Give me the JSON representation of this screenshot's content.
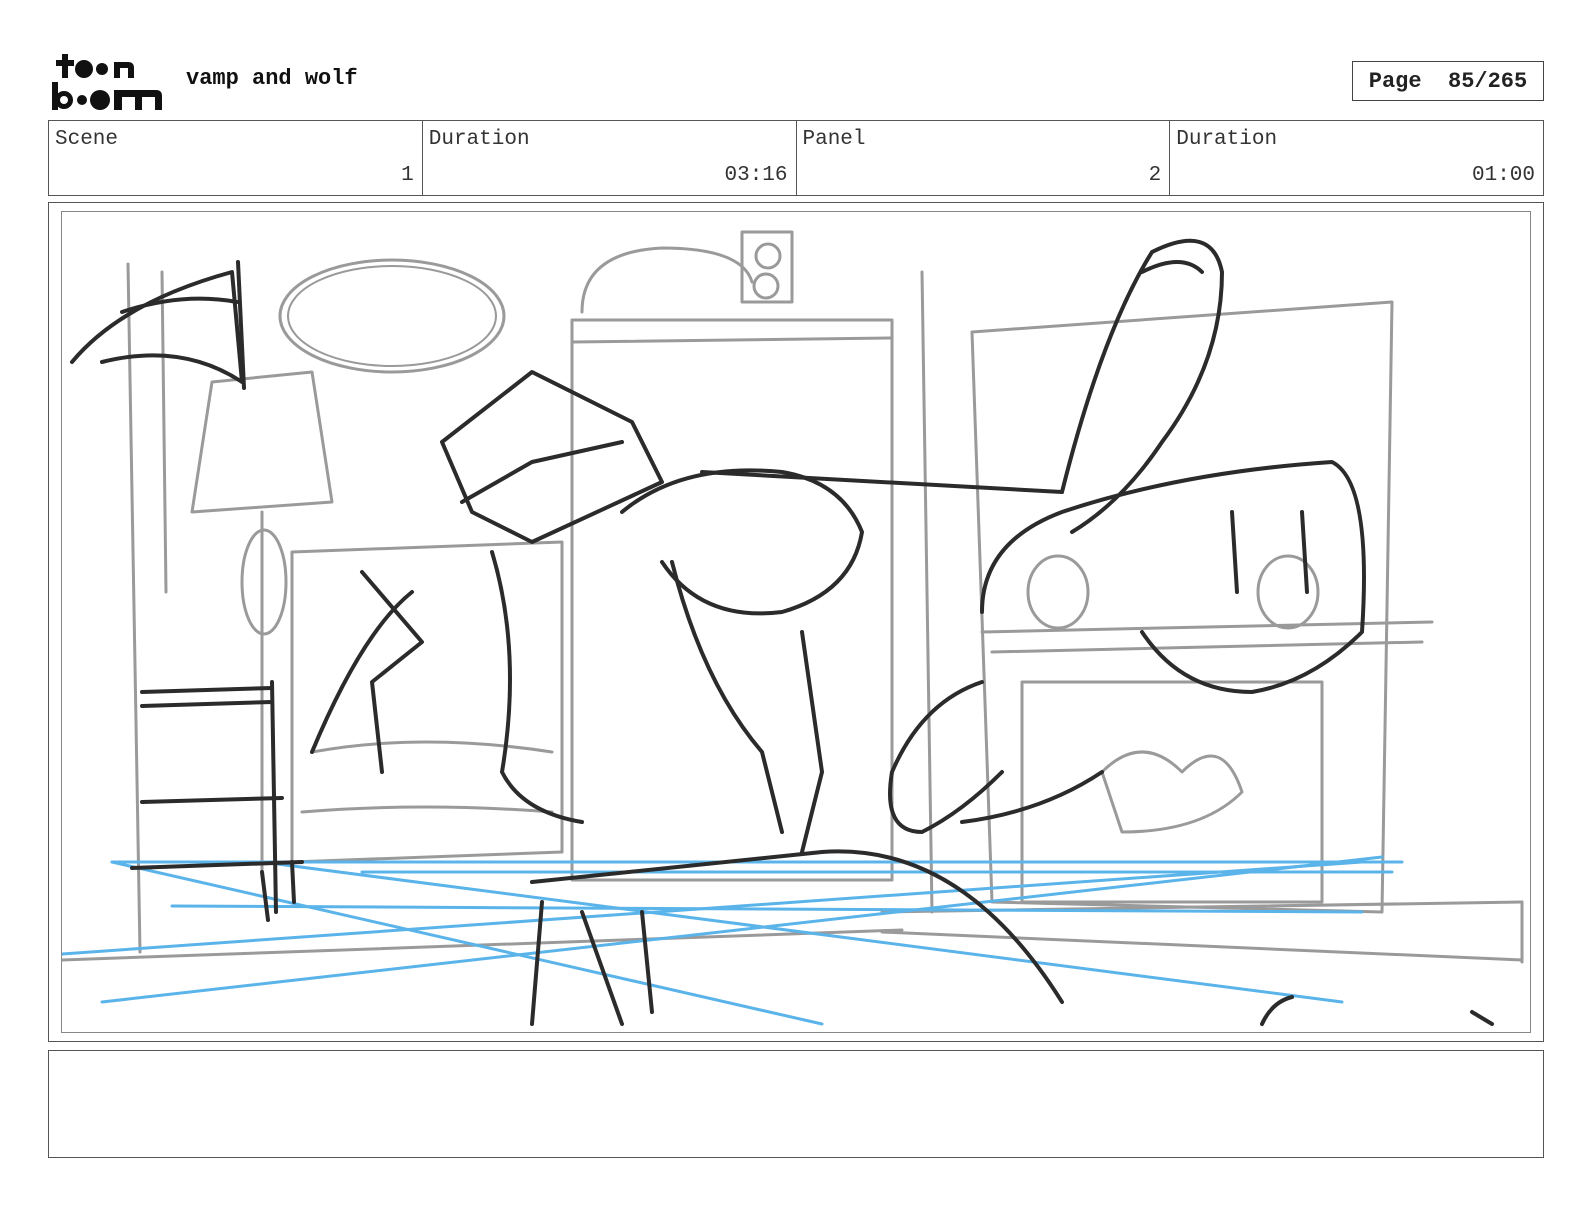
{
  "header": {
    "logo_top": "t●●n",
    "logo_bottom": "b●●m",
    "project_title": "vamp and wolf",
    "page_label": "Page",
    "page_number": "85/265"
  },
  "info": {
    "scene_label": "Scene",
    "scene_value": "1",
    "scene_duration_label": "Duration",
    "scene_duration_value": "03:16",
    "panel_label": "Panel",
    "panel_value": "2",
    "panel_duration_label": "Duration",
    "panel_duration_value": "01:00"
  },
  "panel": {
    "icon": "sketch-drawing",
    "colors": {
      "background_line": "#9a9a9a",
      "character_line": "#2b2b2b",
      "guide_line": "#5ab4ea"
    }
  },
  "notes": {
    "text": ""
  }
}
